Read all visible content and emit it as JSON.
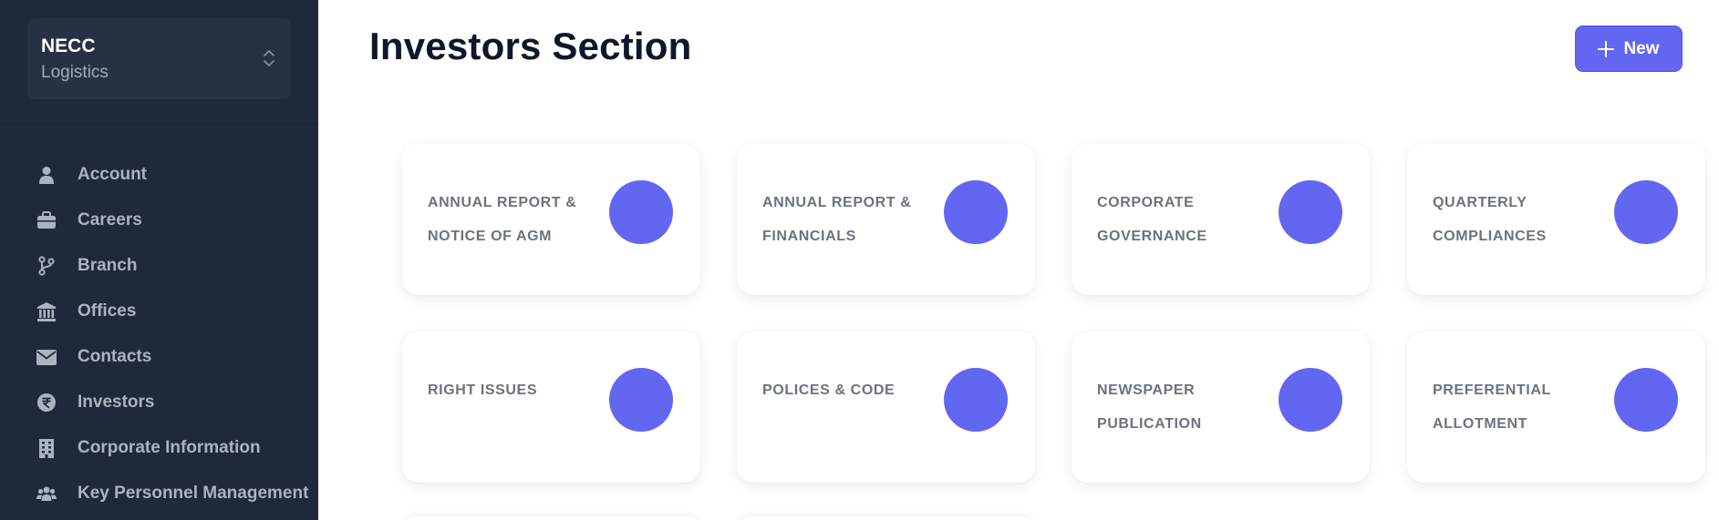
{
  "brand": {
    "title": "NECC",
    "subtitle": "Logistics",
    "chevron_icon": "chevron-up-down-icon"
  },
  "sidebar": {
    "items": [
      {
        "label": "Account",
        "icon": "user-icon"
      },
      {
        "label": "Careers",
        "icon": "briefcase-icon"
      },
      {
        "label": "Branch",
        "icon": "git-branch-icon"
      },
      {
        "label": "Offices",
        "icon": "bank-building-icon"
      },
      {
        "label": "Contacts",
        "icon": "envelope-icon"
      },
      {
        "label": "Investors",
        "icon": "rupee-icon"
      },
      {
        "label": "Corporate Information",
        "icon": "office-building-icon"
      },
      {
        "label": "Key Personnel Management",
        "icon": "user-group-icon"
      }
    ]
  },
  "header": {
    "title": "Investors Section",
    "new_button_label": "New",
    "new_button_icon": "plus-icon"
  },
  "cards": [
    {
      "label": "ANNUAL REPORT & NOTICE OF AGM"
    },
    {
      "label": "ANNUAL REPORT & FINANCIALS"
    },
    {
      "label": "CORPORATE GOVERNANCE"
    },
    {
      "label": "QUARTERLY COMPLIANCES"
    },
    {
      "label": "RIGHT ISSUES"
    },
    {
      "label": "POLICES & CODE"
    },
    {
      "label": "NEWSPAPER PUBLICATION"
    },
    {
      "label": "PREFERENTIAL ALLOTMENT"
    }
  ],
  "colors": {
    "sidebar_bg": "#1e293b",
    "accent": "#6366f1",
    "card_text": "#6b7280",
    "nav_text": "#aab3c0"
  }
}
